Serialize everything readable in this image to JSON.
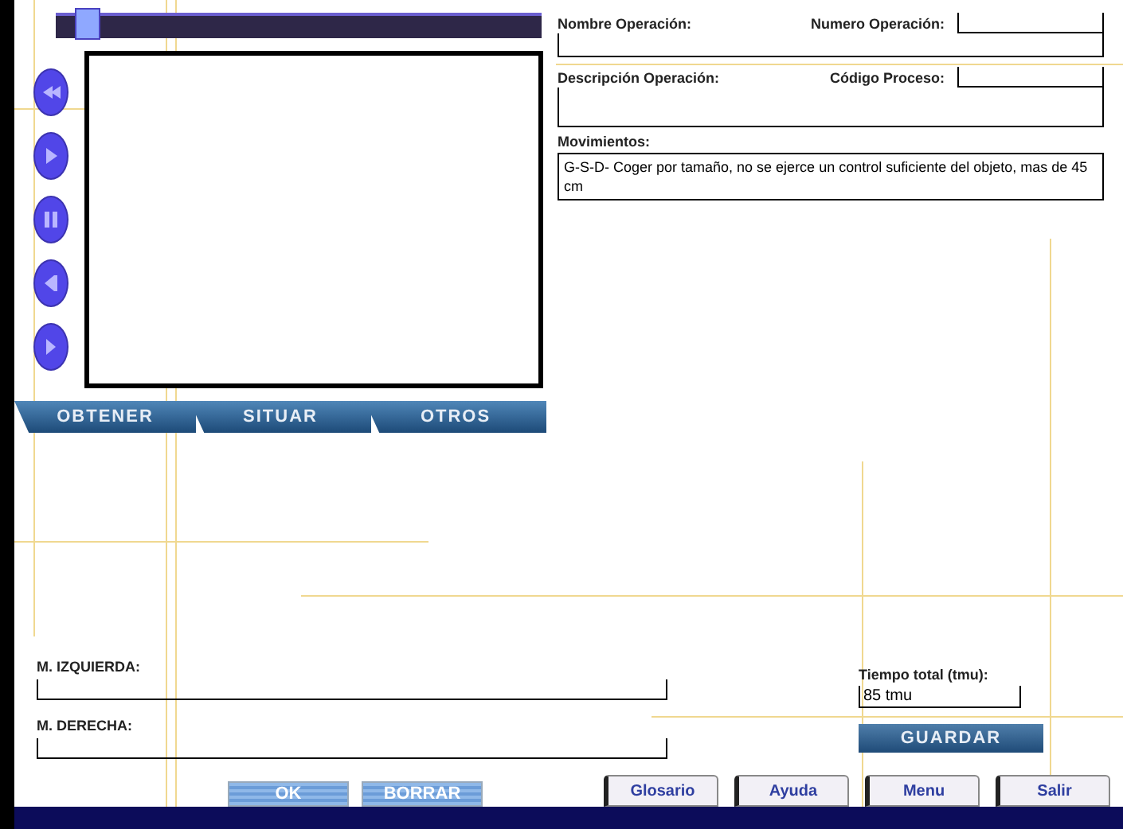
{
  "timeline": {
    "level": 0.04
  },
  "action_tabs": [
    "OBTENER",
    "SITUAR",
    "OTROS"
  ],
  "operation": {
    "name_label": "Nombre Operación:",
    "number_label": "Numero Operación:",
    "description_label": "Descripción Operación:",
    "process_code_label": "Código Proceso:",
    "movements_label": "Movimientos:",
    "movements_value": "G-S-D- Coger por tamaño, no se ejerce un control suficiente del objeto, mas de 45 cm"
  },
  "hands": [
    {
      "label": "M. IZQUIERDA:"
    },
    {
      "label": "M. DERECHA:"
    }
  ],
  "total_time": {
    "label": "Tiempo total (tmu):",
    "value": "85 tmu"
  },
  "save_button": "GUARDAR",
  "form_buttons": [
    "OK",
    "BORRAR"
  ],
  "nav_tabs": [
    "Glosario",
    "Ayuda",
    "Menu",
    "Salir"
  ]
}
